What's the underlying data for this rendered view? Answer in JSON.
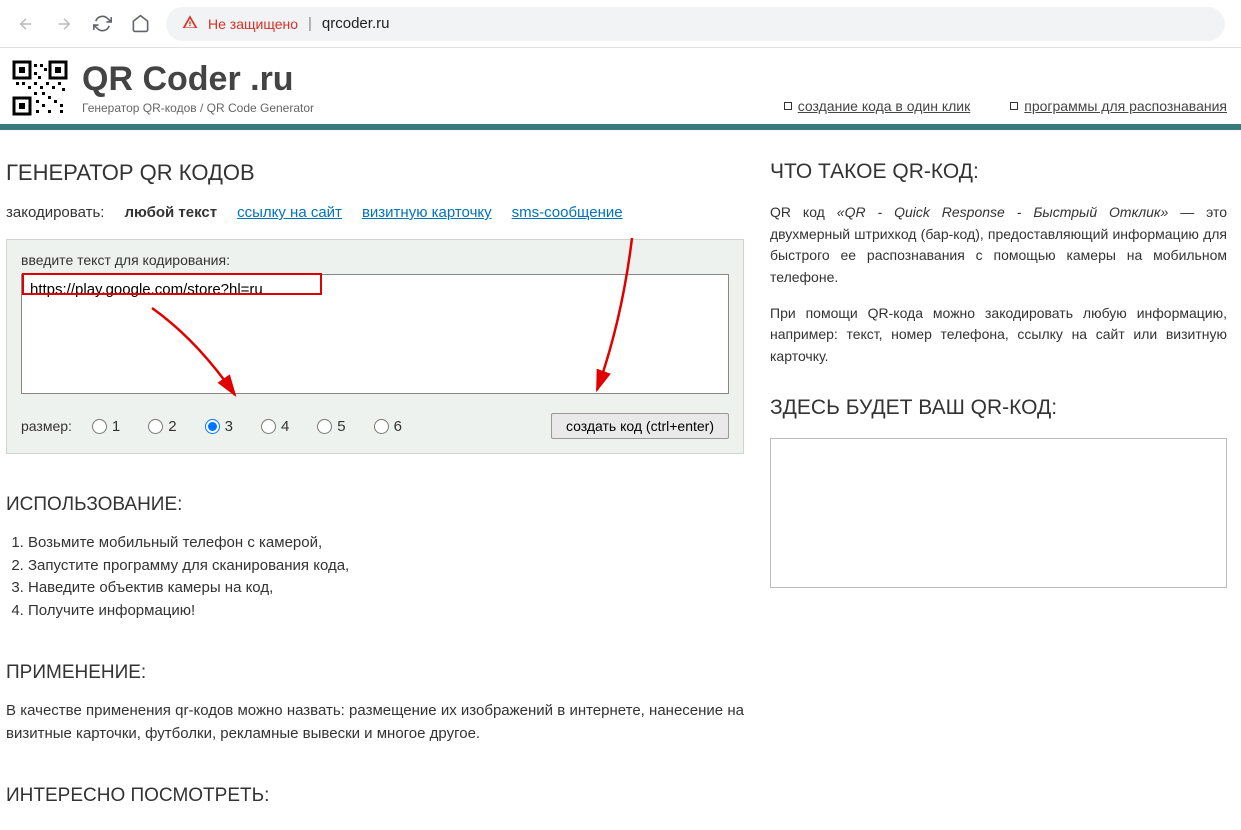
{
  "browser": {
    "not_secure": "Не защищено",
    "url": "qrcoder.ru"
  },
  "header": {
    "title": "QR Coder .ru",
    "subtitle": "Генератор QR-кодов / QR Code Generator",
    "link1": "создание кода в один клик",
    "link2": "программы для распознавания"
  },
  "main": {
    "heading": "ГЕНЕРАТОР QR КОДОВ",
    "encode_label": "закодировать:",
    "tabs": {
      "any_text": "любой текст",
      "url": "ссылку на сайт",
      "vcard": "визитную карточку",
      "sms": "sms-сообщение"
    },
    "form": {
      "label": "введите текст для кодирования:",
      "value": "https://play.google.com/store?hl=ru",
      "size_label": "размер:",
      "sizes": {
        "r1": "1",
        "r2": "2",
        "r3": "3",
        "r4": "4",
        "r5": "5",
        "r6": "6"
      },
      "selected_size": "3",
      "button": "создать код (ctrl+enter)"
    },
    "usage": {
      "heading": "ИСПОЛЬЗОВАНИЕ:",
      "step1": "Возьмите мобильный телефон с камерой,",
      "step2": "Запустите программу для сканирования кода,",
      "step3": "Наведите объектив камеры на код,",
      "step4": "Получите информацию!"
    },
    "application": {
      "heading": "ПРИМЕНЕНИЕ:",
      "text": "В качестве применения qr-кодов можно назвать: размещение их изображений в интернете, нанесение на визитные карточки, футболки, рекламные вывески и многое другое."
    },
    "interesting": {
      "heading": "ИНТЕРЕСНО ПОСМОТРЕТЬ:"
    }
  },
  "aside": {
    "what_heading": "ЧТО ТАКОЕ QR-КОД:",
    "p1a": "QR код ",
    "p1i": "«QR - Quick Response - Быстрый Отклик»",
    "p1b": " — это двухмерный штрихкод (бар-код), предоставляющий информацию для быстрого ее распознавания с помощью камеры на мобильном телефоне.",
    "p2": "При помощи QR-кода можно закодировать любую информацию, например: текст, номер телефона, ссылку на сайт или визитную карточку.",
    "output_heading": "ЗДЕСЬ БУДЕТ ВАШ QR-КОД:"
  }
}
